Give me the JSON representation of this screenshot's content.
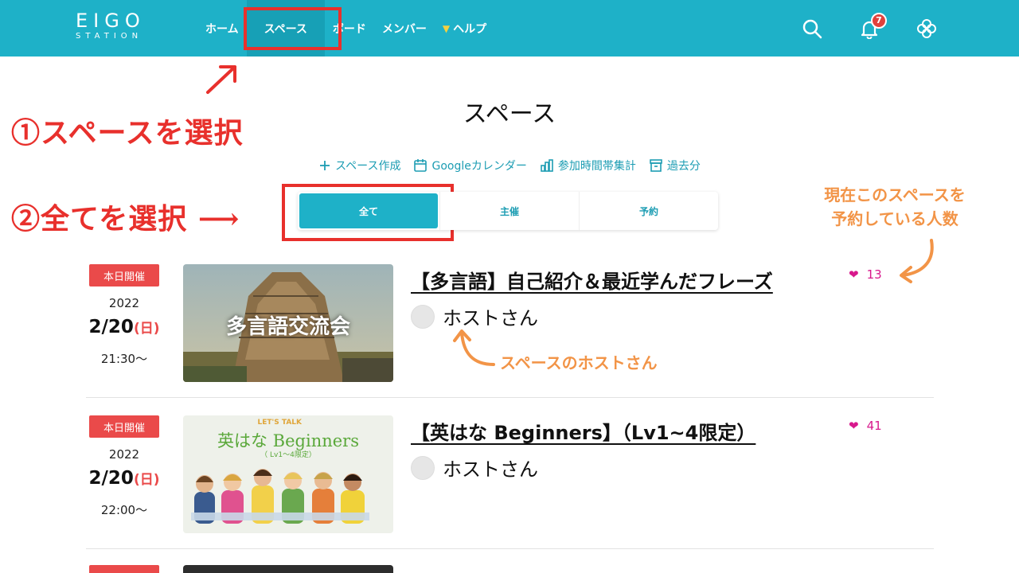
{
  "header": {
    "logo_top": "EIGO",
    "logo_bottom": "STATION",
    "nav": [
      {
        "label": "ホーム"
      },
      {
        "label": "スペース"
      },
      {
        "label": "ボード"
      },
      {
        "label": "メンバー"
      },
      {
        "label": "ヘルプ"
      }
    ],
    "notification_count": "7"
  },
  "page_title": "スペース",
  "toolbar": {
    "create": "スペース作成",
    "calendar": "Googleカレンダー",
    "stats": "参加時間帯集計",
    "archive": "過去分"
  },
  "tabs": [
    "全て",
    "主催",
    "予約"
  ],
  "annotations": {
    "step1": "①スペースを選択",
    "step2": "②全てを選択 ⟶",
    "reserve_note_line1": "現在このスペースを",
    "reserve_note_line2": "予約している人数",
    "host_note": "スペースのホストさん"
  },
  "events": [
    {
      "tag": "本日開催",
      "year": "2022",
      "date": "2/20",
      "dow": "(日)",
      "time": "21:30〜",
      "thumb_text": "多言語交流会",
      "title": "【多言語】自己紹介＆最近学んだフレーズ",
      "host": "ホストさん",
      "likes": "13"
    },
    {
      "tag": "本日開催",
      "year": "2022",
      "date": "2/20",
      "dow": "(日)",
      "time": "22:00〜",
      "thumb_top": "LET'S TALK",
      "thumb_text": "英はな Beginners",
      "thumb_sub": "（ Lv1〜4限定）",
      "title": "【英はな Beginners】（Lv1~4限定）",
      "host": "ホストさん",
      "likes": "41"
    }
  ],
  "colors": {
    "header_bg": "#1eb1c8",
    "accent": "#1d9db3",
    "tag_red": "#ea4a4a",
    "like_pink": "#d8188c",
    "annot_red": "#e8302c",
    "annot_orange": "#f29447"
  }
}
